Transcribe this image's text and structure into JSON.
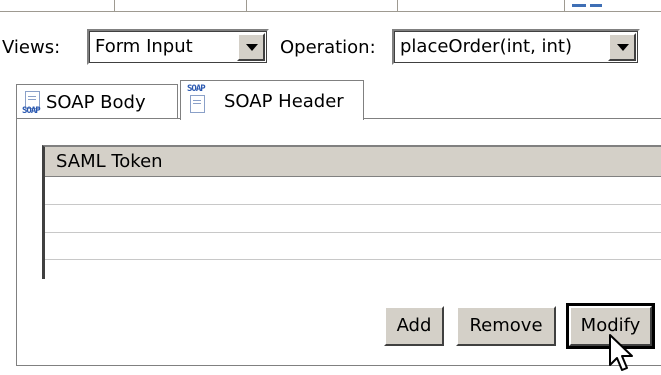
{
  "filters": {
    "views_label": "Views:",
    "views_value": "Form Input",
    "operation_label": "Operation:",
    "operation_value": "placeOrder(int, int)"
  },
  "tabs": [
    {
      "label": "SOAP Body",
      "icon": "soap-body-icon",
      "selected": false
    },
    {
      "label": "SOAP Header",
      "icon": "soap-header-icon",
      "selected": true
    }
  ],
  "icon_text": "SOAP",
  "table": {
    "header": "SAML Token",
    "rows": []
  },
  "buttons": {
    "add": "Add",
    "remove": "Remove",
    "modify": "Modify"
  },
  "colors": {
    "panel_gray": "#d4d0c8",
    "border_dark": "#404040",
    "icon_blue": "#2a58b0"
  }
}
